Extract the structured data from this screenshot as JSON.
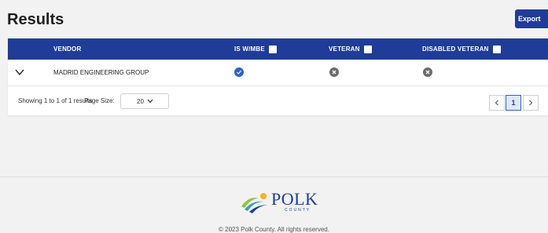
{
  "page": {
    "title": "Results"
  },
  "toolbar": {
    "export_label": "Export"
  },
  "table": {
    "columns": {
      "vendor": "VENDOR",
      "is_wmbe": "IS W/MBE",
      "veteran": "VETERAN",
      "disabled_veteran": "DISABLED VETERAN"
    },
    "rows": [
      {
        "vendor": "MADRID ENGINEERING GROUP",
        "is_wmbe": true,
        "veteran": false,
        "disabled_veteran": false
      }
    ]
  },
  "pagination": {
    "showing_text": "Showing 1 to 1 of 1 results",
    "page_size_label": "Page Size:",
    "page_size_value": "20",
    "prev_icon": "chevron-left-icon",
    "next_icon": "chevron-right-icon",
    "current_page": "1"
  },
  "footer": {
    "logo_text": "POLK",
    "logo_sub": "COUNTY",
    "copyright": "© 2023 Polk County. All rights reserved."
  },
  "colors": {
    "header": "#1f3c98",
    "check": "#2a5fd8",
    "x": "#6b6b6b"
  }
}
